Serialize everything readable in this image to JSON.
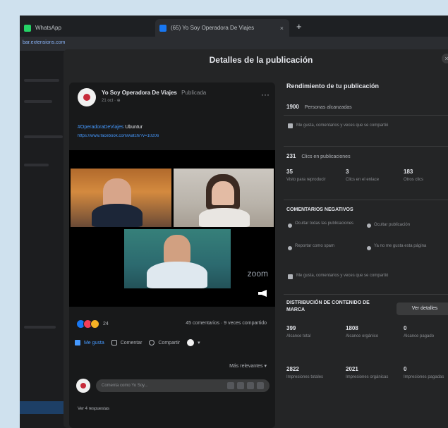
{
  "browser": {
    "tabs": [
      {
        "label": "WhatsApp",
        "color": "#25d366",
        "close": ""
      },
      {
        "label": "(65) Yo Soy Operadora De Viajes",
        "color": "#1877f2",
        "close": "×"
      }
    ],
    "new_tab": "+",
    "address": "bar.extensions.com"
  },
  "modal": {
    "title": "Detalles de la publicación",
    "close": "×"
  },
  "post": {
    "author": "Yo Soy Operadora De Viajes",
    "author_suffix": "Publicada",
    "meta": "21 oct · ⊕",
    "menu": "···",
    "hashtag": "#OperadoraDeViajes",
    "hashtag_tail": "Ubuntur",
    "link": "https://www.facebook.com/watch/?v=10206",
    "zoom_label": "zoom",
    "reaction_count": "24",
    "comments_shares": "45 comentarios · 9 veces compartido",
    "actions": {
      "like": "Me gusta",
      "comment": "Comentar",
      "share": "Compartir"
    },
    "relevant": "Más relevantes ▾",
    "comment_placeholder": "Comenta como Yo Soy...",
    "see_more": "Ver 4 respuestas"
  },
  "insights": {
    "title": "Rendimiento de tu publicación",
    "reach": {
      "value": "1900",
      "label": "Personas alcanzadas"
    },
    "reactions_note": "Me gusta, comentarios y veces que se compartió",
    "interactions": {
      "value": "231",
      "label": "Clics en publicaciones"
    },
    "click_stats": [
      {
        "value": "35",
        "label": "Visto para reproducir"
      },
      {
        "value": "3",
        "label": "Clics en el enlace"
      },
      {
        "value": "183",
        "label": "Otros clics"
      }
    ],
    "negative_title": "COMENTARIOS NEGATIVOS",
    "negative_items": [
      {
        "value": "",
        "label": "Ocultar todas las publicaciones"
      },
      {
        "value": "",
        "label": "Ocultar publicación"
      },
      {
        "value": "",
        "label": "Reportar como spam"
      },
      {
        "value": "",
        "label": "Ya no me gusta esta página"
      }
    ],
    "distribution_title": "DISTRIBUCIÓN DE CONTENIDO DE MARCA",
    "details_button": "Ver detalles",
    "distribution": [
      {
        "value": "399",
        "label": "Alcance total"
      },
      {
        "value": "1808",
        "label": "Alcance orgánico"
      },
      {
        "value": "0",
        "label": "Alcance pagado"
      },
      {
        "value": "2822",
        "label": "Impresiones totales"
      },
      {
        "value": "2021",
        "label": "Impresiones orgánicas"
      },
      {
        "value": "0",
        "label": "Impresiones pagadas"
      }
    ]
  }
}
